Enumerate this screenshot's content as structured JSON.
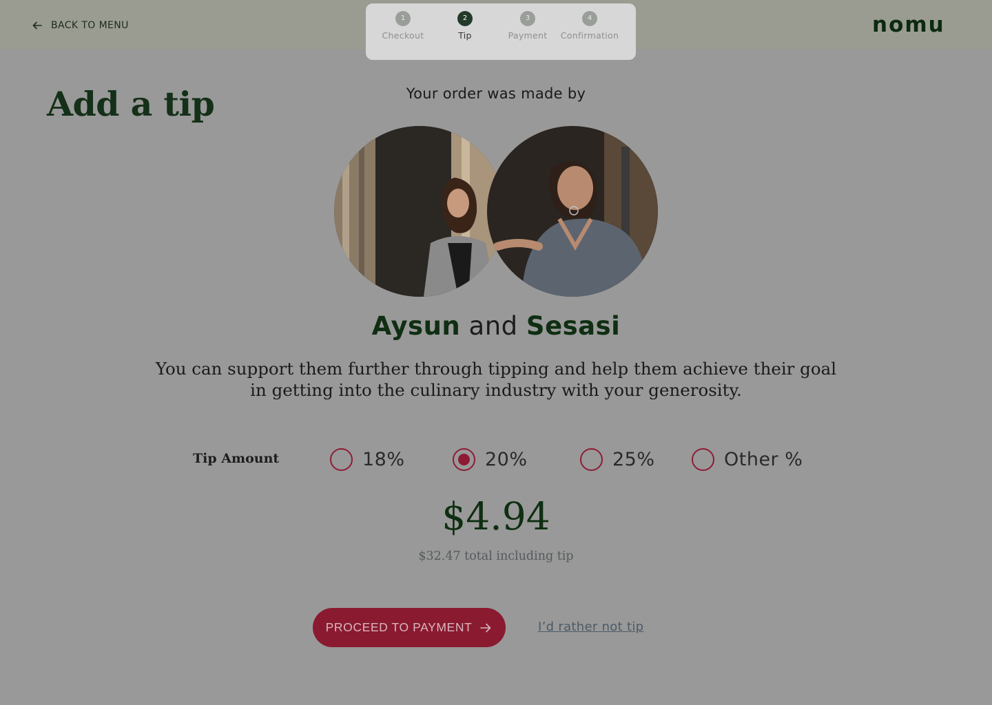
{
  "header": {
    "back_label": "BACK TO MENU",
    "logo": "nomu",
    "steps": [
      {
        "num": "1",
        "label": "Checkout"
      },
      {
        "num": "2",
        "label": "Tip"
      },
      {
        "num": "3",
        "label": "Payment"
      },
      {
        "num": "4",
        "label": "Confirmation"
      }
    ],
    "active_step": 2
  },
  "page": {
    "title": "Add a tip",
    "made_by": "Your order was made by",
    "chef1": "Aysun",
    "and_word": "and",
    "chef2": "Sesasi",
    "support_text": "You can support them further through tipping and help them achieve their goal in getting into the culinary industry with your generosity."
  },
  "tip": {
    "label": "Tip Amount",
    "options": [
      "18%",
      "20%",
      "25%",
      "Other %"
    ],
    "selected": "20%",
    "amount": "$4.94",
    "total": "$32.47 total including tip"
  },
  "actions": {
    "proceed_label": "PROCEED TO PAYMENT",
    "no_tip_label": "I’d rather not tip"
  },
  "icons": {
    "back": "arrow-left-icon",
    "proceed": "arrow-right-icon"
  },
  "colors": {
    "brand_green": "#0f2e12",
    "accent_red": "#8a1a30",
    "active_step": "#233a2b"
  }
}
